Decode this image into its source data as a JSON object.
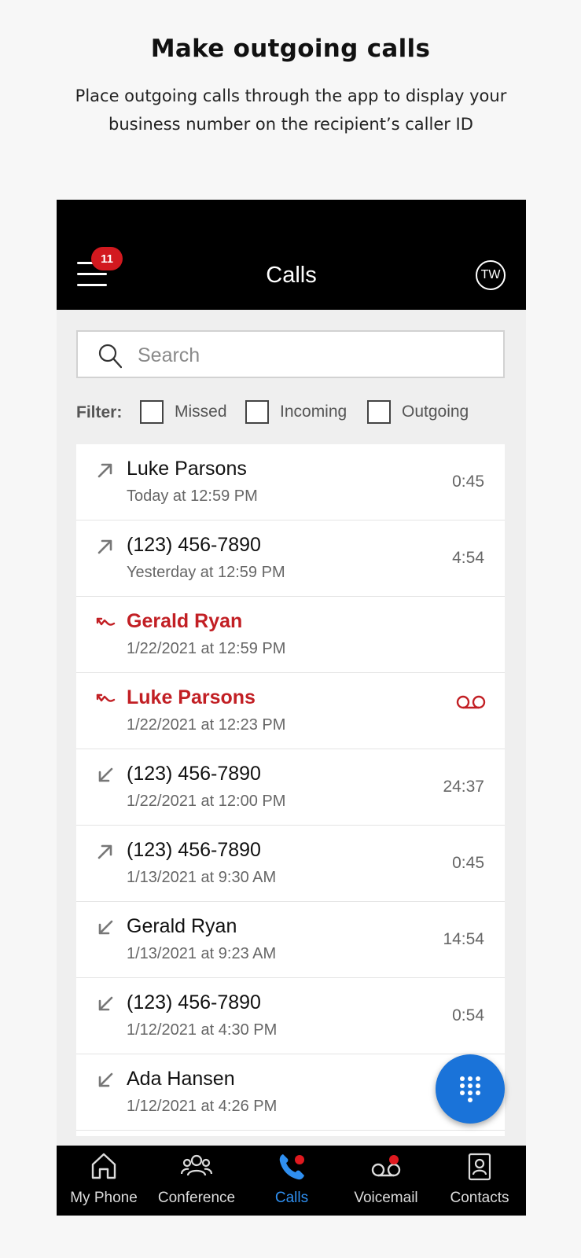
{
  "promo": {
    "title": "Make outgoing calls",
    "subtitle": "Place outgoing calls through the app to display your business number on the recipient’s caller ID"
  },
  "appbar": {
    "title": "Calls",
    "menu_badge_count": "11",
    "avatar_initials": "TW"
  },
  "search": {
    "placeholder": "Search",
    "value": ""
  },
  "filter": {
    "label": "Filter:",
    "options": [
      {
        "label": "Missed",
        "checked": false
      },
      {
        "label": "Incoming",
        "checked": false
      },
      {
        "label": "Outgoing",
        "checked": false
      }
    ]
  },
  "calls": [
    {
      "name": "Luke Parsons",
      "when": "Today at 12:59 PM",
      "duration": "0:45",
      "type": "outgoing"
    },
    {
      "name": "(123) 456-7890",
      "when": "Yesterday at 12:59 PM",
      "duration": "4:54",
      "type": "outgoing"
    },
    {
      "name": "Gerald Ryan",
      "when": "1/22/2021 at 12:59 PM",
      "duration": "",
      "type": "missed"
    },
    {
      "name": "Luke Parsons",
      "when": "1/22/2021 at 12:23 PM",
      "duration": "",
      "type": "missed",
      "voicemail": true
    },
    {
      "name": "(123) 456-7890",
      "when": "1/22/2021 at 12:00 PM",
      "duration": "24:37",
      "type": "incoming"
    },
    {
      "name": "(123) 456-7890",
      "when": "1/13/2021 at 9:30 AM",
      "duration": "0:45",
      "type": "outgoing"
    },
    {
      "name": "Gerald Ryan",
      "when": "1/13/2021 at 9:23 AM",
      "duration": "14:54",
      "type": "incoming"
    },
    {
      "name": "(123) 456-7890",
      "when": "1/12/2021 at 4:30 PM",
      "duration": "0:54",
      "type": "incoming"
    },
    {
      "name": "Ada Hansen",
      "when": "1/12/2021 at 4:26 PM",
      "duration": "",
      "type": "incoming"
    }
  ],
  "icons": {
    "outgoing": "arrow-up-right-icon",
    "incoming": "arrow-down-left-icon",
    "missed": "missed-call-icon",
    "voicemail": "voicemail-icon",
    "dialpad": "dialpad-icon"
  },
  "bottom_nav": [
    {
      "label": "My Phone",
      "icon": "home-icon",
      "active": false,
      "notification": false
    },
    {
      "label": "Conference",
      "icon": "people-icon",
      "active": false,
      "notification": false
    },
    {
      "label": "Calls",
      "icon": "phone-icon",
      "active": true,
      "notification": true
    },
    {
      "label": "Voicemail",
      "icon": "voicemail-icon",
      "active": false,
      "notification": true
    },
    {
      "label": "Contacts",
      "icon": "contact-card-icon",
      "active": false,
      "notification": false
    }
  ],
  "colors": {
    "accent_blue": "#1a73d9",
    "active_tab_blue": "#2f8ff0",
    "missed_red": "#c21f24",
    "badge_red": "#d2191f",
    "appbar_black": "#000000"
  }
}
